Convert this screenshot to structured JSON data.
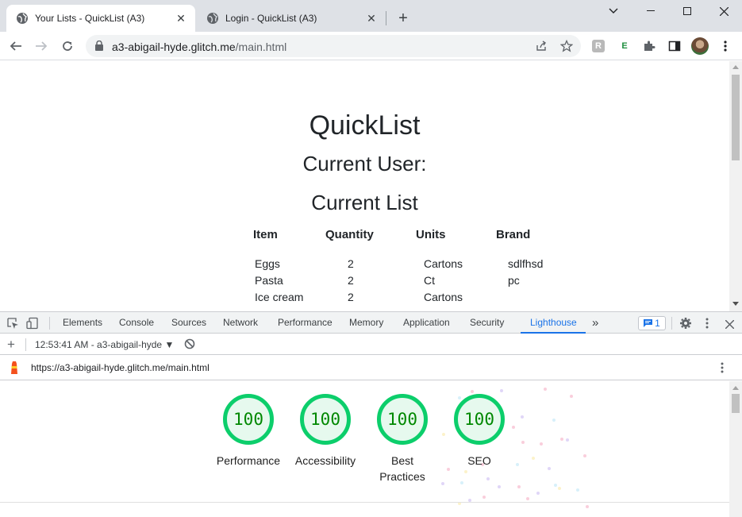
{
  "browser": {
    "tabs": [
      {
        "title": "Your Lists - QuickList (A3)",
        "active": true
      },
      {
        "title": "Login - QuickList (A3)",
        "active": false
      }
    ],
    "url_host": "a3-abigail-hyde.glitch.me",
    "url_path": "/main.html"
  },
  "page": {
    "title": "QuickList",
    "current_user": "Current User:",
    "current_list": "Current List",
    "columns": [
      "Item",
      "Quantity",
      "Units",
      "Brand"
    ],
    "rows": [
      {
        "item": "Eggs",
        "quantity": "2",
        "units": "Cartons",
        "brand": "sdlfhsd"
      },
      {
        "item": "Pasta",
        "quantity": "2",
        "units": "Ct",
        "brand": "pc"
      },
      {
        "item": "Ice cream",
        "quantity": "2",
        "units": "Cartons",
        "brand": ""
      }
    ]
  },
  "devtools": {
    "tabs": [
      "Elements",
      "Console",
      "Sources",
      "Network",
      "Performance",
      "Memory",
      "Application",
      "Security",
      "Lighthouse"
    ],
    "active_tab": "Lighthouse",
    "issues_count": "1",
    "report_selector": "12:53:41 AM - a3-abigail-hyde",
    "report_url": "https://a3-abigail-hyde.glitch.me/main.html",
    "scores": [
      {
        "value": "100",
        "label": "Performance"
      },
      {
        "value": "100",
        "label": "Accessibility"
      },
      {
        "value": "100",
        "label": "Best Practices"
      },
      {
        "value": "100",
        "label": "SEO"
      }
    ]
  },
  "colors": {
    "pass": "#0cce6b",
    "pass_text": "#008800",
    "accent": "#1a73e8"
  }
}
